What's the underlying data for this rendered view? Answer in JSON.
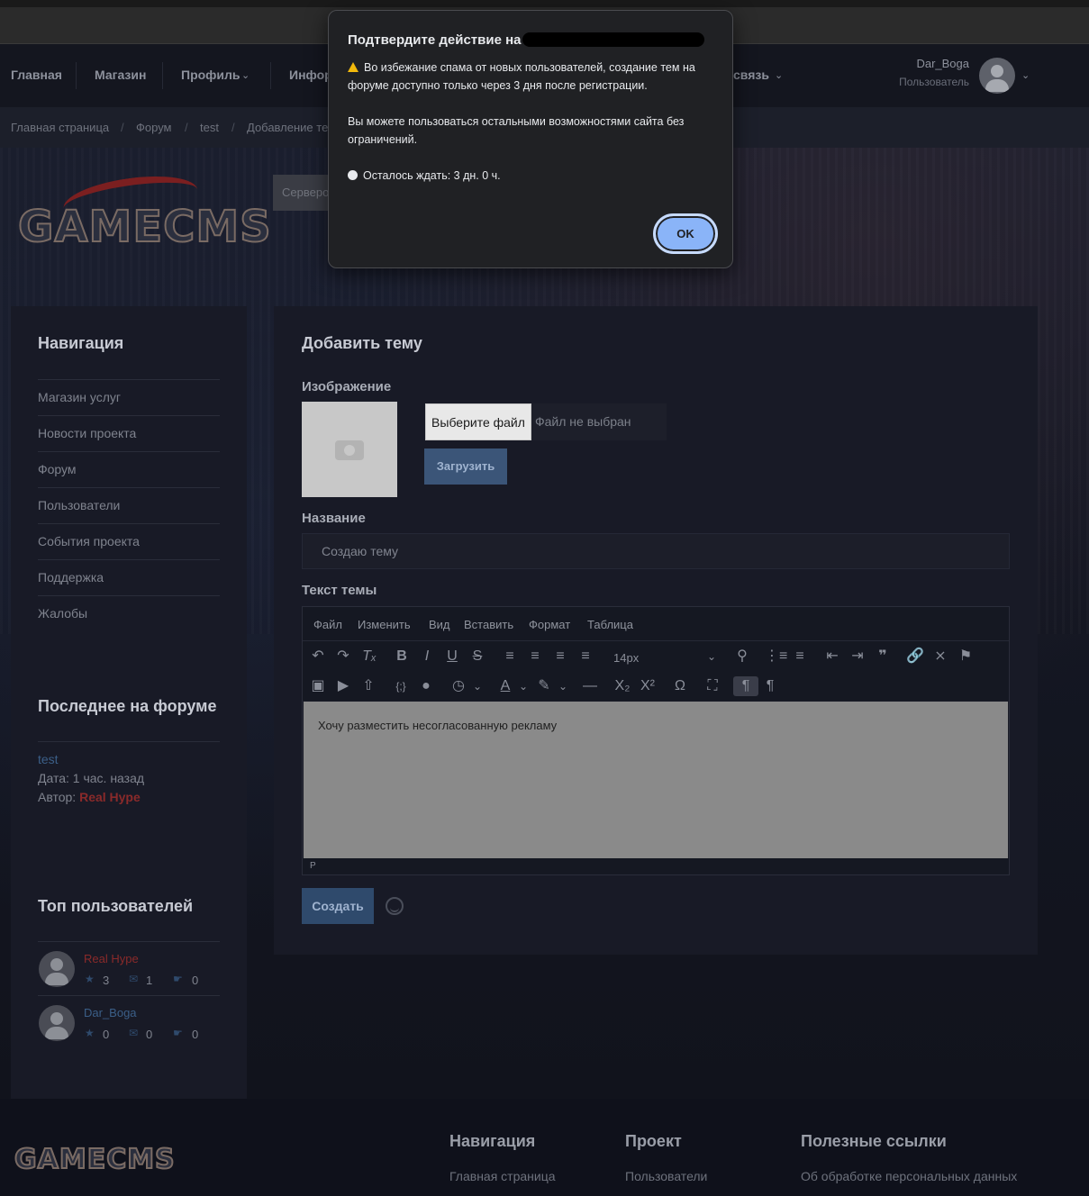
{
  "navbar": {
    "items": [
      "Главная",
      "Магазин",
      "Профиль",
      "Инфор",
      "связь"
    ],
    "user": {
      "name": "Dar_Boga",
      "role": "Пользователь"
    }
  },
  "breadcrumb": [
    "Главная страница",
    "Форум",
    "test",
    "Добавление те"
  ],
  "server_box": "Серверо",
  "logo": "GAMECMS",
  "sidebar": {
    "nav_title": "Навигация",
    "links": [
      "Магазин услуг",
      "Новости проекта",
      "Форум",
      "Пользователи",
      "События проекта",
      "Поддержка",
      "Жалобы"
    ],
    "forum_title": "Последнее на форуме",
    "forum_post": {
      "title": "test",
      "date_label": "Дата: 1 час. назад",
      "author_label": "Автор:",
      "author": "Real Hype"
    },
    "top_title": "Топ пользователей",
    "top_users": [
      {
        "name": "Real Hype",
        "stars": "3",
        "messages": "1",
        "likes": "0",
        "color": "#8a2a2a"
      },
      {
        "name": "Dar_Boga",
        "stars": "0",
        "messages": "0",
        "likes": "0",
        "color": "#3b5f88"
      }
    ]
  },
  "main": {
    "title": "Добавить тему",
    "image_label": "Изображение",
    "choose_file": "Выберите файл",
    "no_file": "Файл не выбран",
    "upload": "Загрузить",
    "name_label": "Название",
    "name_value": "Создаю тему",
    "text_label": "Текст темы",
    "editor": {
      "menu": [
        "Файл",
        "Изменить",
        "Вид",
        "Вставить",
        "Формат",
        "Таблица"
      ],
      "font_size": "14px",
      "content": "Хочу разместить несогласованную рекламу",
      "status": "P"
    },
    "create": "Создать"
  },
  "footer": {
    "cols": [
      {
        "title": "Навигация",
        "link": "Главная страница"
      },
      {
        "title": "Проект",
        "link": "Пользователи"
      },
      {
        "title": "Полезные ссылки",
        "link": "Об обработке персональных данных"
      }
    ]
  },
  "dialog": {
    "title": "Подтвердите действие на",
    "line1": "Во избежание спама от новых пользователей, создание тем на форуме доступно только через 3 дня после регистрации.",
    "line2": "Вы можете пользоваться остальными возможностями сайта без ограничений.",
    "line3": "Осталось ждать: 3 дн. 0 ч.",
    "ok": "OK"
  }
}
